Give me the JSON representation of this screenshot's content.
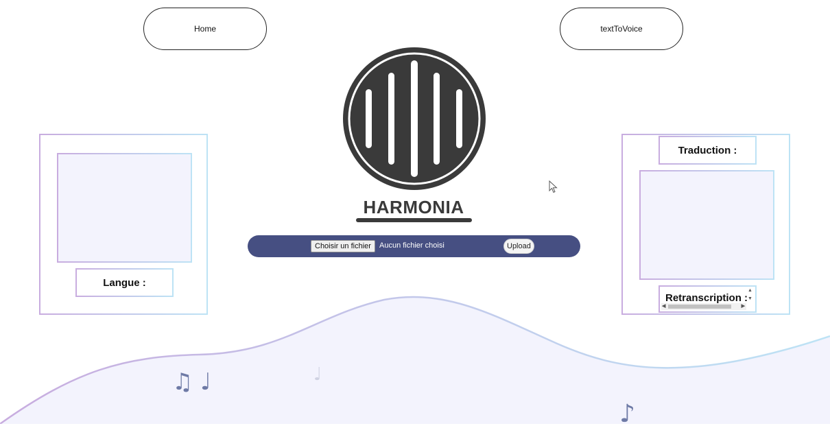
{
  "nav": {
    "home_label": "Home",
    "text_to_voice_label": "textToVoice"
  },
  "brand": {
    "title": "HARMONIA",
    "logo_icon": "sound-wave-circle-icon"
  },
  "upload": {
    "choose_file_label": "Choisir un fichier",
    "file_status": "Aucun fichier choisi",
    "upload_label": "Upload"
  },
  "left_panel": {
    "text_value": "",
    "language_label": "Langue :"
  },
  "right_panel": {
    "translation_label": "Traduction :",
    "text_value": "",
    "transcription_label": "Retranscription :"
  },
  "decorations": {
    "notes": [
      "beamed-eighth-notes-icon",
      "quarter-note-icon",
      "quarter-note-icon",
      "eighth-note-icon"
    ]
  },
  "colors": {
    "upload_bar": "#464f82",
    "logo": "#3a3a3a",
    "panel_gradient_start": "#c8acdf",
    "panel_gradient_end": "#bde3f5",
    "wave_fill": "#f3f3fd",
    "note_color": "#6e7aa6"
  }
}
